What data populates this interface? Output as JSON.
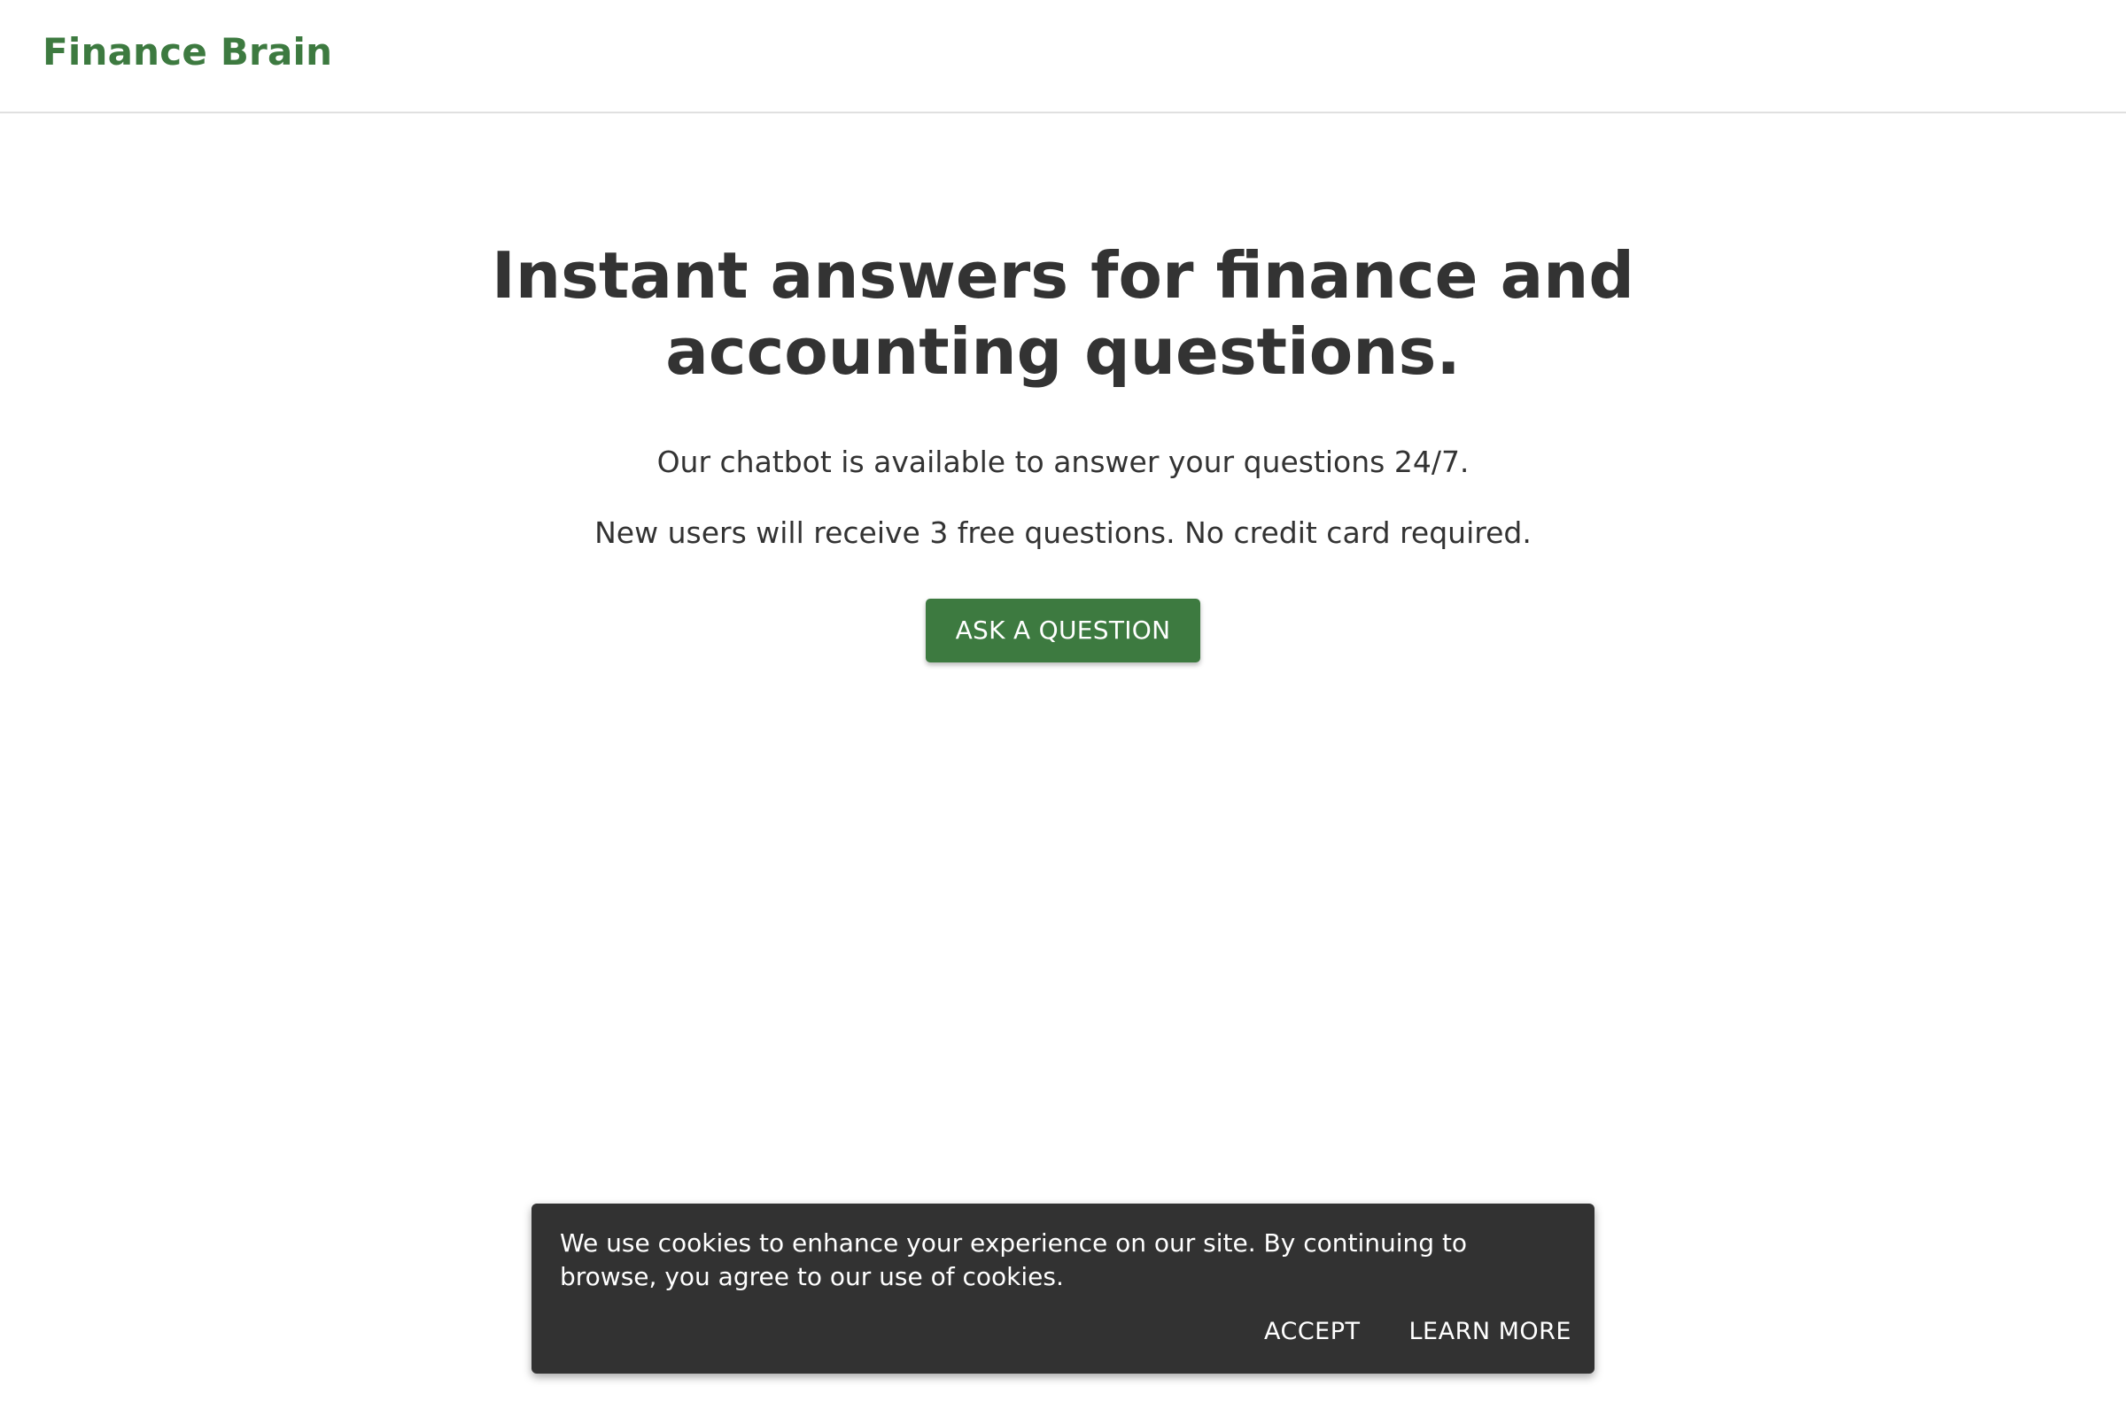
{
  "header": {
    "brand": "Finance Brain"
  },
  "hero": {
    "title": "Instant answers for finance and accounting questions.",
    "line1": "Our chatbot is available to answer your questions 24/7.",
    "line2": "New users will receive 3 free questions. No credit card required.",
    "cta_label": "ASK A QUESTION"
  },
  "cookie_banner": {
    "message": "We use cookies to enhance your experience on our site. By continuing to browse, you agree to our use of cookies.",
    "accept_label": "ACCEPT",
    "learn_more_label": "LEARN MORE"
  },
  "colors": {
    "brand_green": "#3d7a40",
    "text_dark": "#333333",
    "banner_bg": "#323232"
  }
}
